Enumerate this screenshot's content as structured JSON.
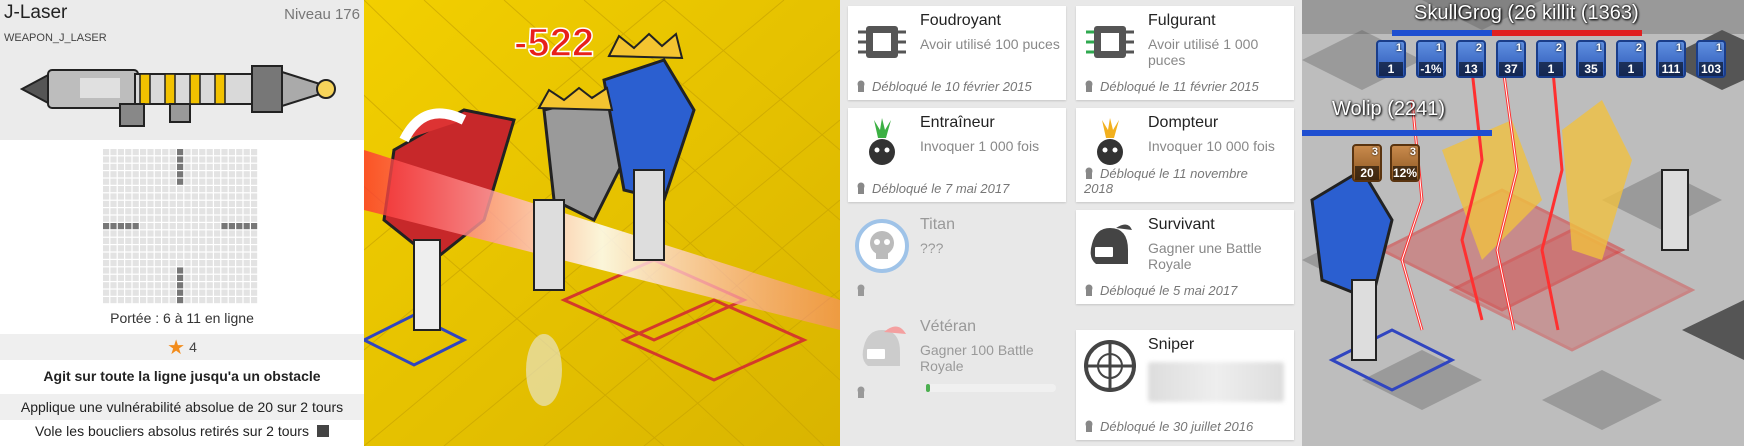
{
  "weapon": {
    "name": "J-Laser",
    "level": "Niveau 176",
    "id": "WEAPON_J_LASER",
    "range": "Portée : 6 à 11 en ligne",
    "cost": "4",
    "effects": [
      "Agit sur toute la ligne jusqu'a un obstacle",
      "Applique une vulnérabilité absolue de 20 sur 2 tours",
      "Vole les boucliers absolus retirés sur 2 tours"
    ]
  },
  "fight": {
    "damage": "-522"
  },
  "trophies": [
    {
      "name": "Foudroyant",
      "desc": "Avoir utilisé 100 puces",
      "date": "Débloqué le 10 février 2015",
      "icon": "chip-icon",
      "locked": false
    },
    {
      "name": "Fulgurant",
      "desc": "Avoir utilisé 1 000 puces",
      "date": "Débloqué le 11 février 2015",
      "icon": "chip-green-icon",
      "locked": false
    },
    {
      "name": "Entraîneur",
      "desc": "Invoquer 1 000 fois",
      "date": "Débloqué le 7 mai 2017",
      "icon": "bulb-green-icon",
      "locked": false
    },
    {
      "name": "Dompteur",
      "desc": "Invoquer 10 000 fois",
      "date": "Débloqué le 11 novembre 2018",
      "icon": "bulb-yellow-icon",
      "locked": false
    },
    {
      "name": "Titan",
      "desc": "???",
      "date": "",
      "icon": "skull-icon",
      "locked": true
    },
    {
      "name": "Survivant",
      "desc": "Gagner une Battle Royale",
      "date": "Débloqué le 5 mai 2017",
      "icon": "helmet-icon",
      "locked": false
    },
    {
      "name": "Vétéran",
      "desc": "Gagner 100 Battle Royale",
      "date": "",
      "icon": "helmet-red-icon",
      "locked": true,
      "progress": 0.03
    },
    {
      "name": "Sniper",
      "desc": "",
      "date": "Débloqué le 30 juillet 2016",
      "icon": "crosshair-icon",
      "locked": false
    }
  ],
  "hud": {
    "top_names": "SkullGrog (26",
    "top_names2": "killit (1363)",
    "player": "Wolip (2241)",
    "top_buffs": [
      {
        "stacks": "1",
        "value": "1"
      },
      {
        "stacks": "1",
        "value": "-1%"
      },
      {
        "stacks": "2",
        "value": "13"
      },
      {
        "stacks": "1",
        "value": "37"
      },
      {
        "stacks": "2",
        "value": "1"
      },
      {
        "stacks": "1",
        "value": "35"
      },
      {
        "stacks": "2",
        "value": "1"
      },
      {
        "stacks": "1",
        "value": "111"
      },
      {
        "stacks": "1",
        "value": "103"
      }
    ],
    "player_buffs": [
      {
        "stacks": "3",
        "value": "20"
      },
      {
        "stacks": "3",
        "value": "12%"
      }
    ]
  },
  "colors": {
    "accent_orange": "#f28c1c",
    "damage_red": "#e8201a",
    "board_yellow": "#f6d400",
    "progress_green": "#4caf50"
  }
}
